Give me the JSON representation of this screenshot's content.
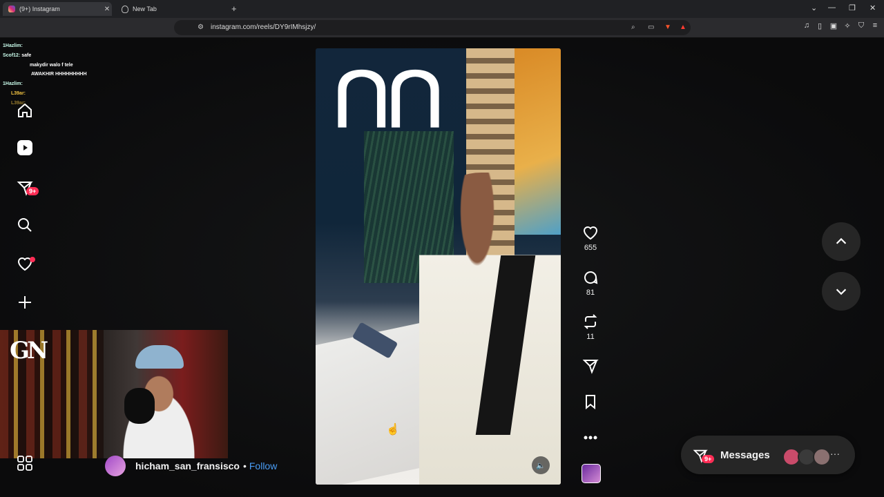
{
  "browser": {
    "tabs": [
      {
        "title": "(9+) Instagram",
        "active": true
      },
      {
        "title": "New Tab",
        "active": false
      }
    ],
    "new_tab": "+",
    "url": "instagram.com/reels/DY9rIMhsjzy/",
    "window_controls": {
      "chevron": "⌄",
      "minimize": "—",
      "restore": "❐",
      "close": "✕"
    }
  },
  "sidebar": {
    "direct_badge": "9+",
    "items": [
      "home-icon",
      "reels-icon",
      "direct-icon",
      "search-icon",
      "notifications-icon",
      "create-icon"
    ],
    "more": "grid-icon"
  },
  "stream_chat": [
    {
      "user": "1Hazlim:",
      "msg": "",
      "gold": false
    },
    {
      "user": "Scof12:",
      "msg": "safe",
      "gold": false
    },
    {
      "user": "",
      "msg": "makydir walo f tele",
      "gold": false
    },
    {
      "user": "",
      "msg": "AWAKHIR HHHHHHHHH",
      "gold": false
    },
    {
      "user": "1Hazlim:",
      "msg": "",
      "gold": false
    },
    {
      "user": "L39ar:",
      "msg": "",
      "gold": true
    },
    {
      "user": "L39ar:",
      "msg": "",
      "gold": true
    }
  ],
  "webcam": {
    "logo_text": "GN"
  },
  "reel": {
    "username": "hicham_san_fransisco",
    "separator": "•",
    "follow_label": "Follow",
    "mute_icon": "🔈"
  },
  "actions": {
    "likes": "655",
    "comments": "81",
    "reposts": "11"
  },
  "messages": {
    "label": "Messages",
    "badge": "9+",
    "more": "···",
    "avatar_colors": [
      "#c94b6a",
      "#3a3a3a",
      "#8a7070"
    ]
  },
  "colors": {
    "accent": "#4a9ef7",
    "badge": "#ff2d55",
    "background": "#0f0f10"
  }
}
